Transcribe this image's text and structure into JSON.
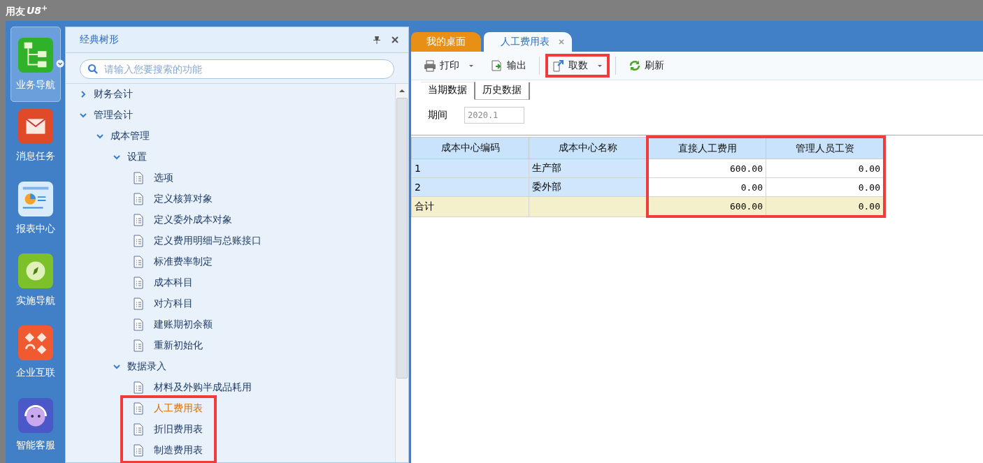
{
  "app_title": {
    "text": "用友",
    "product": "U8",
    "sup": "+"
  },
  "rail": [
    {
      "label": "业务导航",
      "selected": true
    },
    {
      "label": "消息任务",
      "selected": false
    },
    {
      "label": "报表中心",
      "selected": false
    },
    {
      "label": "实施导航",
      "selected": false
    },
    {
      "label": "企业互联",
      "selected": false
    },
    {
      "label": "智能客服",
      "selected": false
    }
  ],
  "tree_panel": {
    "title": "经典树形",
    "search": {
      "placeholder": "请输入您要搜索的功能"
    },
    "items": [
      {
        "kind": "folder",
        "label": "财务会计",
        "expanded": false
      },
      {
        "kind": "folder",
        "label": "管理会计",
        "expanded": true,
        "children": [
          {
            "kind": "folder",
            "label": "成本管理",
            "expanded": true,
            "children": [
              {
                "kind": "folder",
                "label": "设置",
                "expanded": true,
                "children": [
                  {
                    "kind": "item",
                    "label": "选项",
                    "selected": false,
                    "highlighted": false
                  },
                  {
                    "kind": "item",
                    "label": "定义核算对象",
                    "selected": false,
                    "highlighted": false
                  },
                  {
                    "kind": "item",
                    "label": "定义委外成本对象",
                    "selected": false,
                    "highlighted": false
                  },
                  {
                    "kind": "item",
                    "label": "定义费用明细与总账接口",
                    "selected": false,
                    "highlighted": false
                  },
                  {
                    "kind": "item",
                    "label": "标准费率制定",
                    "selected": false,
                    "highlighted": false
                  },
                  {
                    "kind": "item",
                    "label": "成本科目",
                    "selected": false,
                    "highlighted": false
                  },
                  {
                    "kind": "item",
                    "label": "对方科目",
                    "selected": false,
                    "highlighted": false
                  },
                  {
                    "kind": "item",
                    "label": "建账期初余额",
                    "selected": false,
                    "highlighted": false
                  },
                  {
                    "kind": "item",
                    "label": "重新初始化",
                    "selected": false,
                    "highlighted": false
                  }
                ]
              },
              {
                "kind": "folder",
                "label": "数据录入",
                "expanded": true,
                "children": [
                  {
                    "kind": "item",
                    "label": "材料及外购半成品耗用",
                    "selected": false,
                    "highlighted": false
                  },
                  {
                    "kind": "item",
                    "label": "人工费用表",
                    "selected": true,
                    "highlighted": true
                  },
                  {
                    "kind": "item",
                    "label": "折旧费用表",
                    "selected": false,
                    "highlighted": true
                  },
                  {
                    "kind": "item",
                    "label": "制造费用表",
                    "selected": false,
                    "highlighted": true
                  }
                ]
              }
            ]
          }
        ]
      }
    ]
  },
  "tabs": [
    {
      "label": "我的桌面",
      "selected": false,
      "closable": false
    },
    {
      "label": "人工费用表",
      "selected": true,
      "closable": true
    }
  ],
  "toolbar": {
    "groups": [
      [
        {
          "label": "打印",
          "dropdown": true,
          "highlighted": false
        },
        {
          "label": "输出",
          "dropdown": false,
          "highlighted": false
        }
      ],
      [
        {
          "label": "取数",
          "dropdown": true,
          "highlighted": true
        }
      ],
      [
        {
          "label": "刷新",
          "dropdown": false,
          "highlighted": false
        }
      ]
    ]
  },
  "sub_tabs": [
    {
      "label": "当期数据",
      "selected": true
    },
    {
      "label": "历史数据",
      "selected": false
    }
  ],
  "period": {
    "label": "期间",
    "value": "2020.1"
  },
  "table": {
    "columns": [
      {
        "label": "成本中心编码",
        "highlighted": false
      },
      {
        "label": "成本中心名称",
        "highlighted": false
      },
      {
        "label": "直接人工费用",
        "highlighted": true
      },
      {
        "label": "管理人员工资",
        "highlighted": true
      }
    ],
    "rows": [
      {
        "kind": "data",
        "cells": [
          "1",
          "生产部",
          "600.00",
          "0.00"
        ]
      },
      {
        "kind": "data",
        "cells": [
          "2",
          "委外部",
          "0.00",
          "0.00"
        ]
      },
      {
        "kind": "total",
        "cells": [
          "合计",
          "",
          "600.00",
          "0.00"
        ]
      }
    ]
  }
}
